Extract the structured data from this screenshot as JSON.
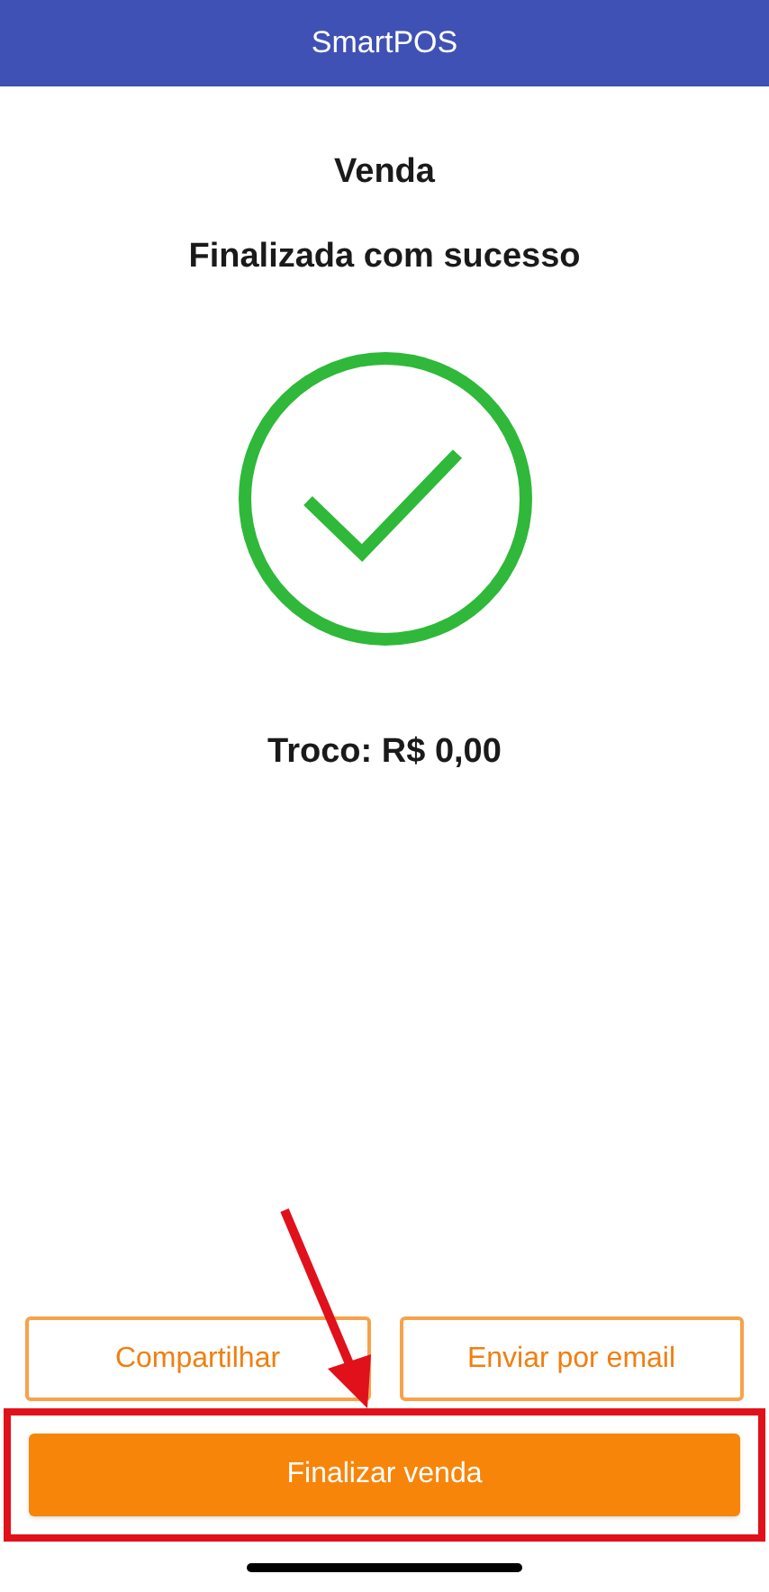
{
  "header": {
    "title": "SmartPOS"
  },
  "status": {
    "title": "Venda",
    "subtitle": "Finalizada com sucesso",
    "change": "Troco: R$ 0,00"
  },
  "actions": [
    {
      "label": "Compartilhar"
    },
    {
      "label": "Enviar por email"
    }
  ],
  "primary_action": {
    "label": "Finalizar venda"
  }
}
